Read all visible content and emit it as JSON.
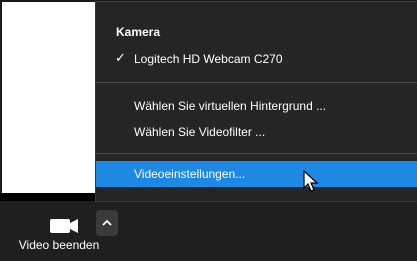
{
  "menu": {
    "heading": "Kamera",
    "camera_option": "Logitech HD Webcam C270",
    "background_option": "Wählen Sie virtuellen Hintergrund ...",
    "filter_option": "Wählen Sie Videofilter ...",
    "settings_option": "Videoeinstellungen..."
  },
  "toolbar": {
    "video_label": "Video beenden"
  },
  "icons": {
    "camera": "video-camera-icon",
    "chevron": "chevron-up-icon",
    "check": "checkmark-icon",
    "cursor": "mouse-pointer-icon"
  },
  "colors": {
    "menu_bg": "#252526",
    "selected_bg": "#1e88e5",
    "toolbar_bg": "#1f1f1f"
  }
}
